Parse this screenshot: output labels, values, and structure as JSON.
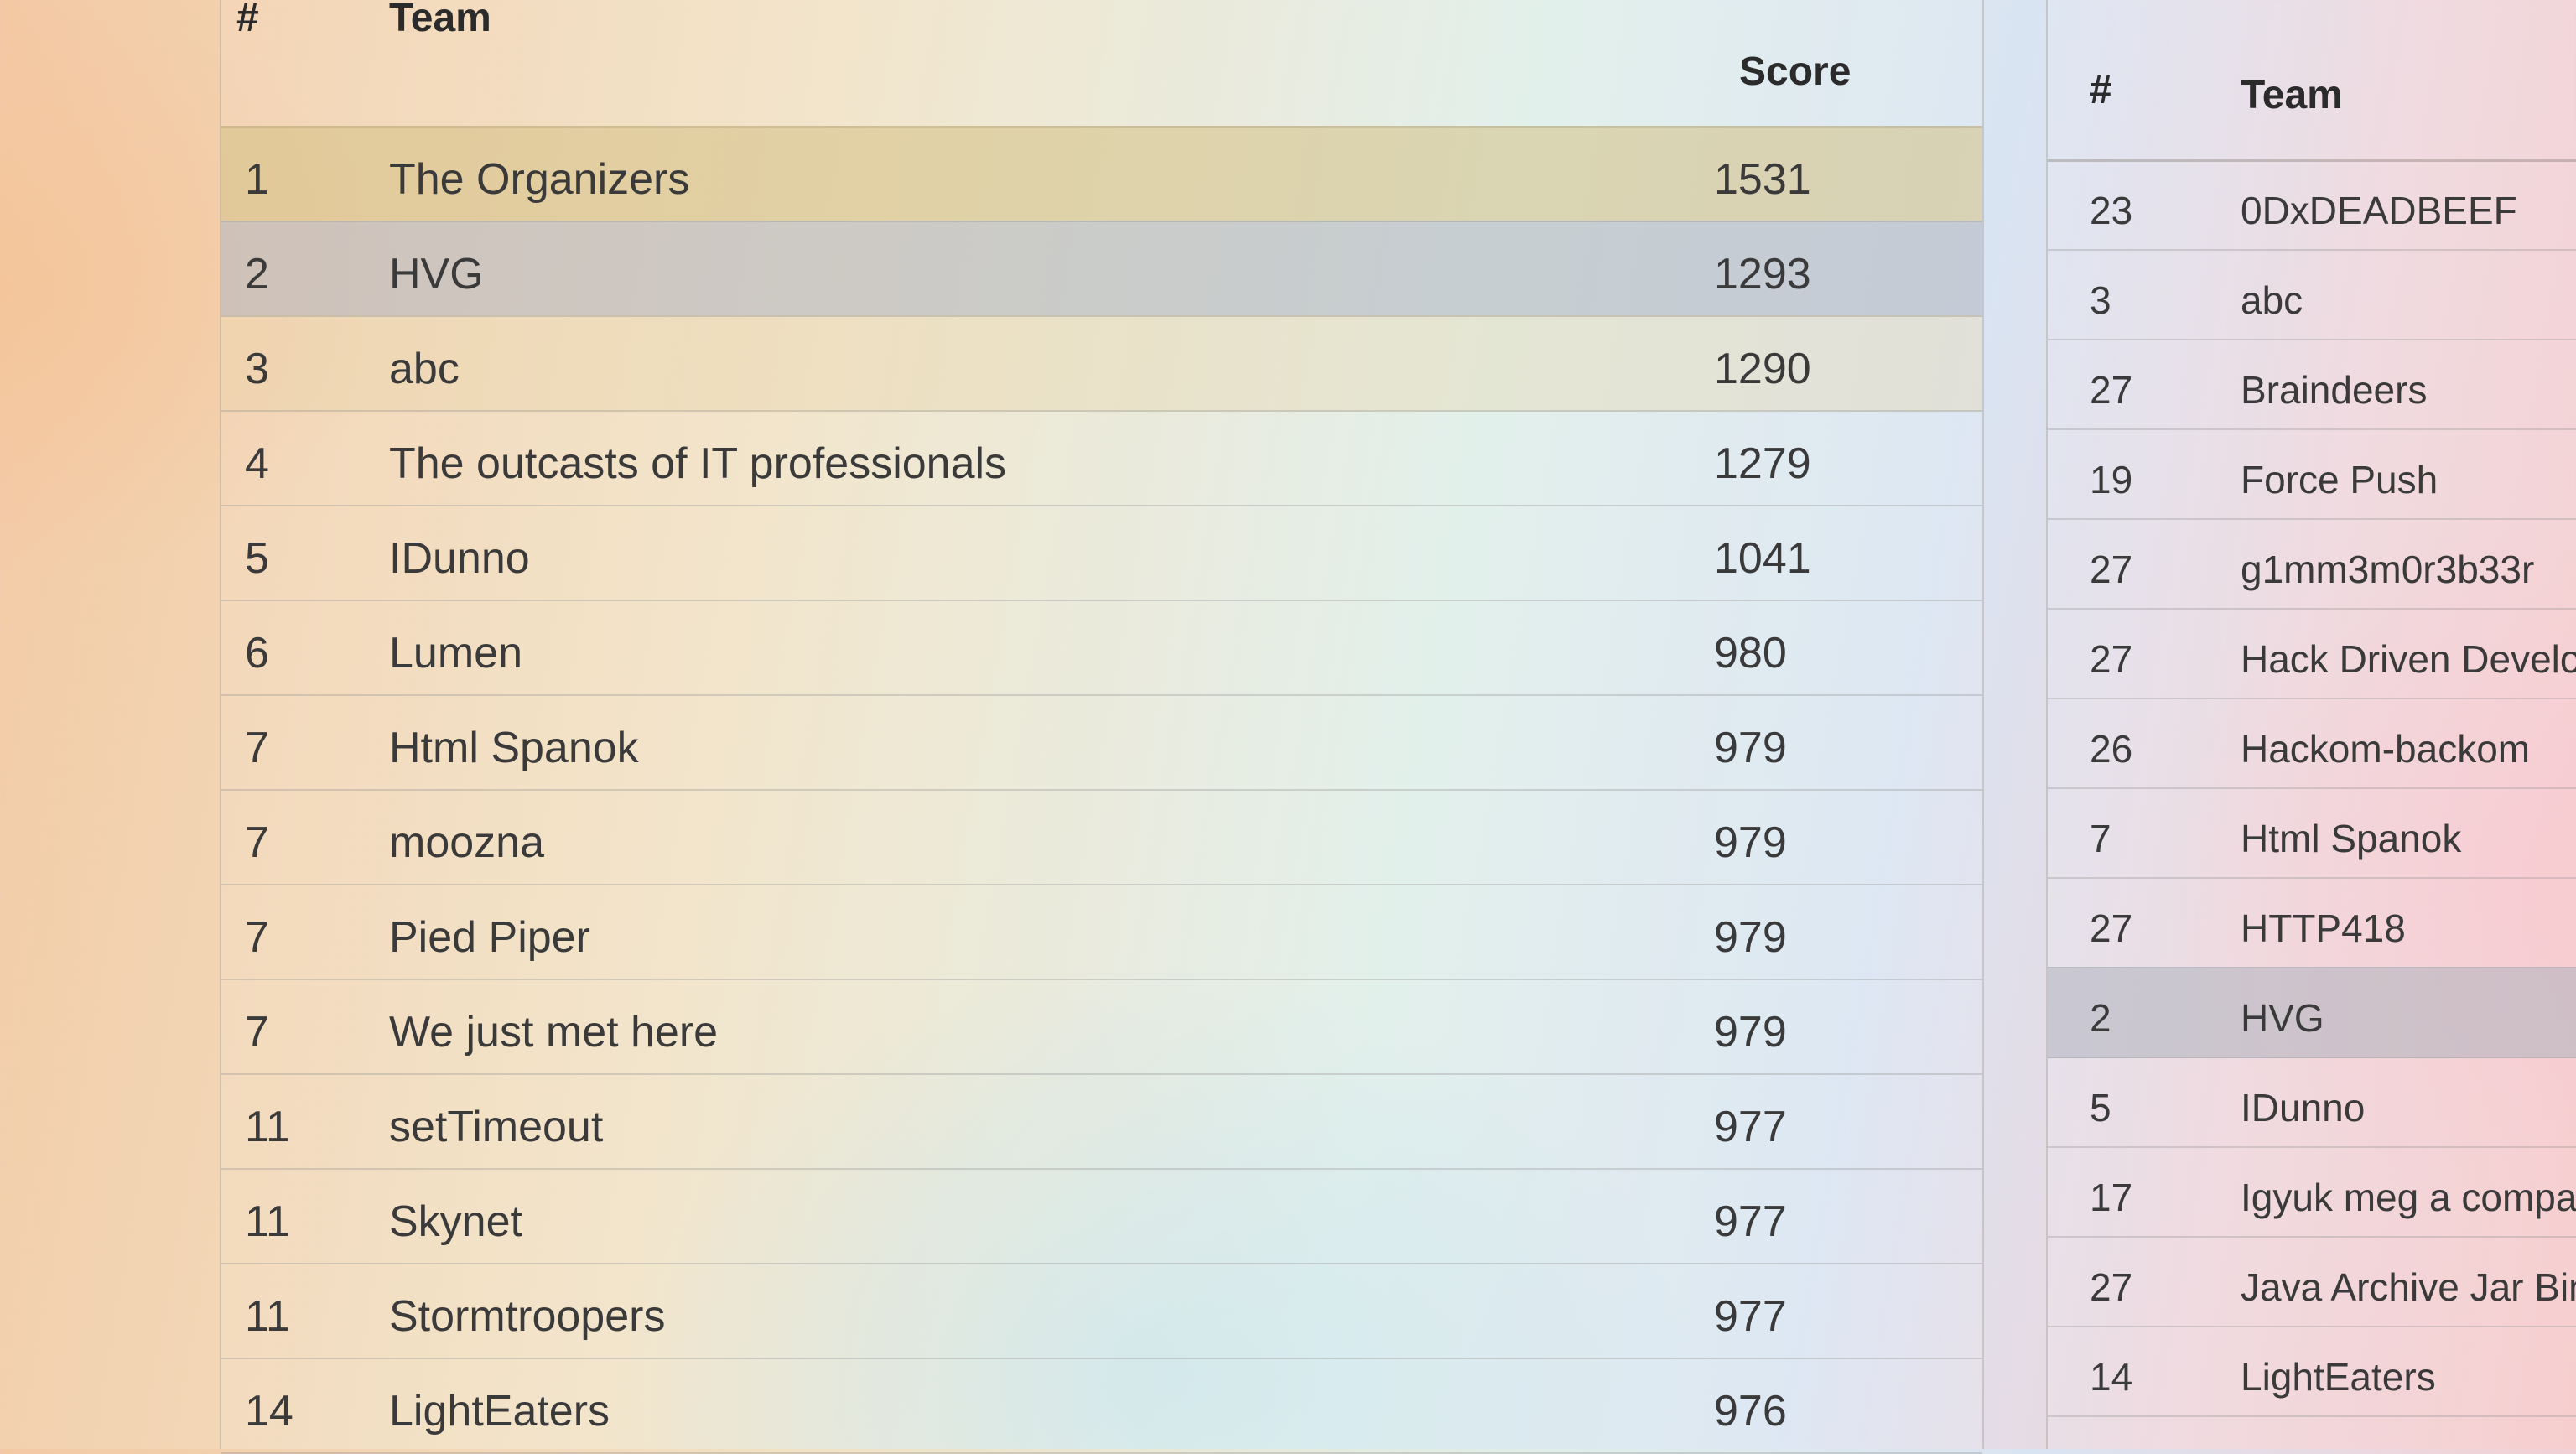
{
  "main_table": {
    "headers": {
      "rank": "#",
      "team": "Team",
      "score": "Score"
    },
    "rows": [
      {
        "rank": "1",
        "team": "The Organizers",
        "score": "1531",
        "highlight": "gold"
      },
      {
        "rank": "2",
        "team": "HVG",
        "score": "1293",
        "highlight": "gray"
      },
      {
        "rank": "3",
        "team": "abc",
        "score": "1290",
        "highlight": "tan"
      },
      {
        "rank": "4",
        "team": "The outcasts of IT professionals",
        "score": "1279",
        "highlight": ""
      },
      {
        "rank": "5",
        "team": "IDunno",
        "score": "1041",
        "highlight": ""
      },
      {
        "rank": "6",
        "team": "Lumen",
        "score": "980",
        "highlight": ""
      },
      {
        "rank": "7",
        "team": "Html Spanok",
        "score": "979",
        "highlight": ""
      },
      {
        "rank": "7",
        "team": "moozna",
        "score": "979",
        "highlight": ""
      },
      {
        "rank": "7",
        "team": "Pied Piper",
        "score": "979",
        "highlight": ""
      },
      {
        "rank": "7",
        "team": "We just met here",
        "score": "979",
        "highlight": ""
      },
      {
        "rank": "11",
        "team": "setTimeout",
        "score": "977",
        "highlight": ""
      },
      {
        "rank": "11",
        "team": "Skynet",
        "score": "977",
        "highlight": ""
      },
      {
        "rank": "11",
        "team": "Stormtroopers",
        "score": "977",
        "highlight": ""
      },
      {
        "rank": "14",
        "team": "LightEaters",
        "score": "976",
        "highlight": ""
      }
    ]
  },
  "side_table": {
    "headers": {
      "rank": "#",
      "team": "Team"
    },
    "rows": [
      {
        "rank": "23",
        "team": "0DxDEADBEEF",
        "highlight": ""
      },
      {
        "rank": "3",
        "team": "abc",
        "highlight": ""
      },
      {
        "rank": "27",
        "team": "Braindeers",
        "highlight": ""
      },
      {
        "rank": "19",
        "team": "Force Push",
        "highlight": ""
      },
      {
        "rank": "27",
        "team": "g1mm3m0r3b33r",
        "highlight": ""
      },
      {
        "rank": "27",
        "team": "Hack Driven Developm",
        "highlight": ""
      },
      {
        "rank": "26",
        "team": "Hackom-backom",
        "highlight": ""
      },
      {
        "rank": "7",
        "team": "Html Spanok",
        "highlight": ""
      },
      {
        "rank": "27",
        "team": "HTTP418",
        "highlight": ""
      },
      {
        "rank": "2",
        "team": "HVG",
        "highlight": "gray"
      },
      {
        "rank": "5",
        "team": "IDunno",
        "highlight": ""
      },
      {
        "rank": "17",
        "team": "Igyuk meg a compareTo-t",
        "highlight": ""
      },
      {
        "rank": "27",
        "team": "Java Archive Jar Binks",
        "highlight": ""
      },
      {
        "rank": "14",
        "team": "LightEaters",
        "highlight": ""
      }
    ]
  },
  "colors": {
    "gold_row": "#d4c084",
    "gray_row": "#afb2be",
    "text": "#3a3a3a"
  }
}
